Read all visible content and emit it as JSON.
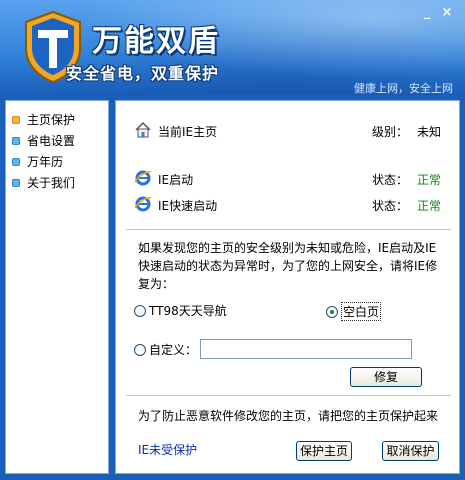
{
  "header": {
    "app_title": "万能双盾",
    "slogan": "安全省电，双重保护",
    "tagline": "健康上网，安全上网",
    "minimize_glyph": "_",
    "close_glyph": "×",
    "logo_icon": "shield-t-logo"
  },
  "sidebar": {
    "items": [
      {
        "label": "主页保护",
        "active": true
      },
      {
        "label": "省电设置",
        "active": false
      },
      {
        "label": "万年历",
        "active": false
      },
      {
        "label": "关于我们",
        "active": false
      }
    ]
  },
  "main": {
    "homepage": {
      "label": "当前IE主页",
      "key": "级别：",
      "value": "未知",
      "icon": "home-icon"
    },
    "ie_start": {
      "label": "IE启动",
      "key": "状态：",
      "value": "正常",
      "icon": "ie-icon"
    },
    "ie_quick": {
      "label": "IE快速启动",
      "key": "状态：",
      "value": "正常",
      "icon": "ie-icon"
    },
    "notice": "如果发现您的主页的安全级别为未知或危险，IE启动及IE快速启动的状态为异常时，为了您的上网安全，请将IE修复为：",
    "options": {
      "tt98": {
        "label": "TT98天天导航",
        "checked": false
      },
      "blank": {
        "label": "空白页",
        "checked": true
      },
      "custom": {
        "label": "自定义：",
        "checked": false,
        "value": ""
      }
    },
    "repair_button": "修复",
    "tip": "为了防止恶意软件修改您的主页，请把您的主页保护起来",
    "protect_status": "IE未受保护",
    "protect_button": "保护主页",
    "cancel_button": "取消保护"
  },
  "colors": {
    "ok_green": "#0a8a0a",
    "link_blue": "#0b2ea8",
    "header_blue": "#2e7fd8"
  }
}
